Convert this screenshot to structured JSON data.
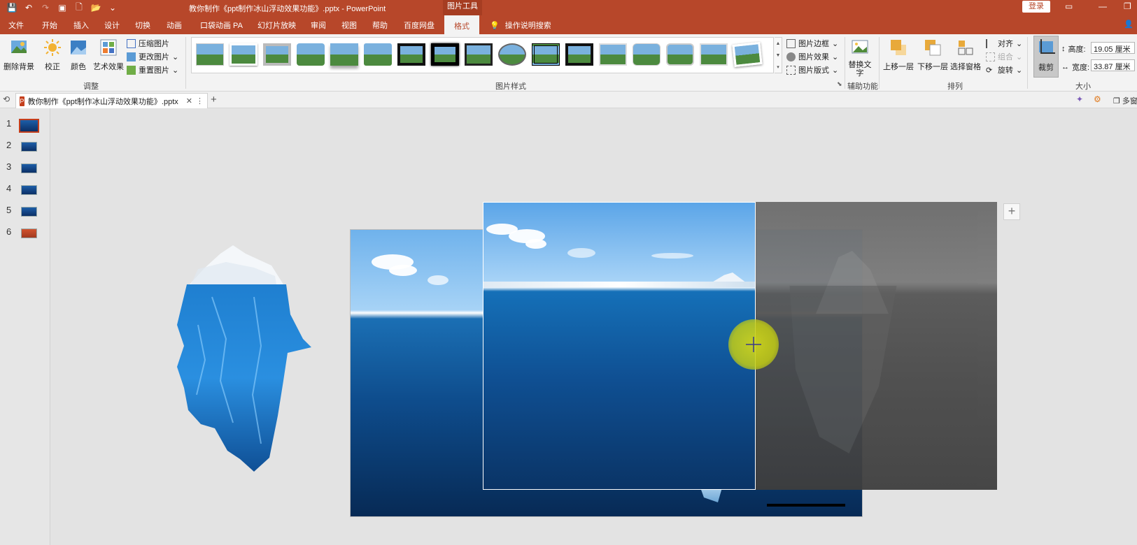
{
  "title_bar": {
    "doc_title": "教你制作《ppt制作冰山浮动效果功能》.pptx  -  PowerPoint",
    "context_tab_group": "图片工具",
    "login": "登录"
  },
  "tabs": [
    "文件",
    "开始",
    "插入",
    "设计",
    "切换",
    "动画",
    "口袋动画 PA",
    "幻灯片放映",
    "审阅",
    "视图",
    "帮助",
    "百度网盘",
    "格式"
  ],
  "active_tab": "格式",
  "tell_me": "操作说明搜索",
  "ribbon": {
    "remove_bg": "删除背景",
    "correct": "校正",
    "color": "颜色",
    "art_effects": "艺术效果",
    "compress": "压缩图片",
    "change": "更改图片",
    "reset": "重置图片",
    "group_adjust": "调整",
    "picture_border": "图片边框",
    "picture_effects": "图片效果",
    "picture_layout": "图片版式",
    "group_styles": "图片样式",
    "alt_text": "替换文字",
    "group_access": "辅助功能",
    "bring_forward": "上移一层",
    "send_backward": "下移一层",
    "selection_pane": "选择窗格",
    "align": "对齐",
    "group_obj": "组合",
    "rotate": "旋转",
    "group_arrange": "排列",
    "crop": "裁剪",
    "height_label": "高度:",
    "height_value": "19.05 厘米",
    "width_label": "宽度:",
    "width_value": "33.87 厘米",
    "group_size": "大小"
  },
  "doc_tab": {
    "label": "教你制作《ppt制作冰山浮动效果功能》.pptx",
    "right_label": "多窗"
  },
  "slides": [
    "1",
    "2",
    "3",
    "4",
    "5",
    "6"
  ],
  "selected_slide": "1",
  "icons": [
    "save-icon",
    "undo-icon",
    "redo-icon",
    "new-icon",
    "open-icon",
    "search-icon",
    "plus-icon"
  ]
}
